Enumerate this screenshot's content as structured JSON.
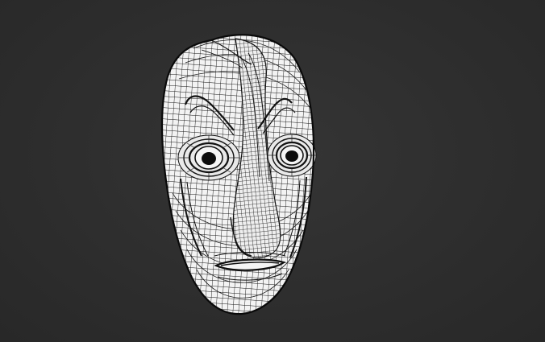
{
  "viewport": {
    "background_color": "#2f2f2f",
    "mesh_fill_color": "#f2f2f2",
    "wire_color": "#111111"
  },
  "model": {
    "subject": "mask",
    "display_mode": "wireframe"
  }
}
